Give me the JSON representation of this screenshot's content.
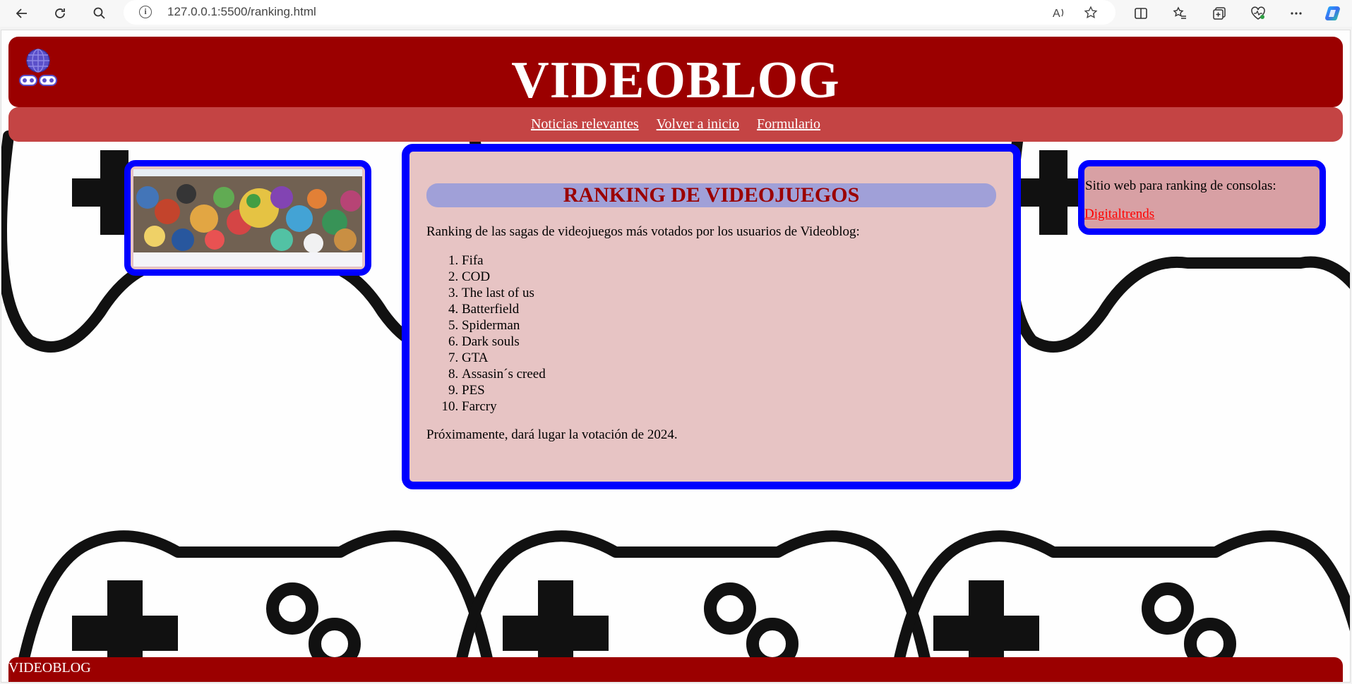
{
  "browser": {
    "url": "127.0.0.1:5500/ranking.html",
    "back_icon": "back-arrow-icon",
    "reload_icon": "reload-icon",
    "search_icon": "search-icon"
  },
  "header": {
    "title": "VIDEOBLOG",
    "logo_icon": "globe-gamepad-logo"
  },
  "nav": {
    "items": [
      {
        "label": "Noticias relevantes"
      },
      {
        "label": "Volver a inicio"
      },
      {
        "label": "Formulario"
      }
    ]
  },
  "main": {
    "heading": "RANKING DE VIDEOJUEGOS",
    "intro": "Ranking de las sagas de videojuegos más votados por los usuarios de Videoblog:",
    "ranking": [
      "Fifa",
      "COD",
      "The last of us",
      "Batterfield",
      "Spiderman",
      "Dark souls",
      "GTA",
      "Assasin´s creed",
      "PES",
      "Farcry"
    ],
    "note": "Próximamente, dará lugar la votación de 2024."
  },
  "side": {
    "label": "Sitio web para ranking de consolas:",
    "link": "Digitaltrends"
  },
  "footer": {
    "text": "VIDEOBLOG"
  },
  "colors": {
    "header": "#9b0000",
    "nav": "#c44444",
    "box_border": "#0000ff",
    "box_bg": "#e7c4c4",
    "heading_bg": "#a0a0d8"
  }
}
